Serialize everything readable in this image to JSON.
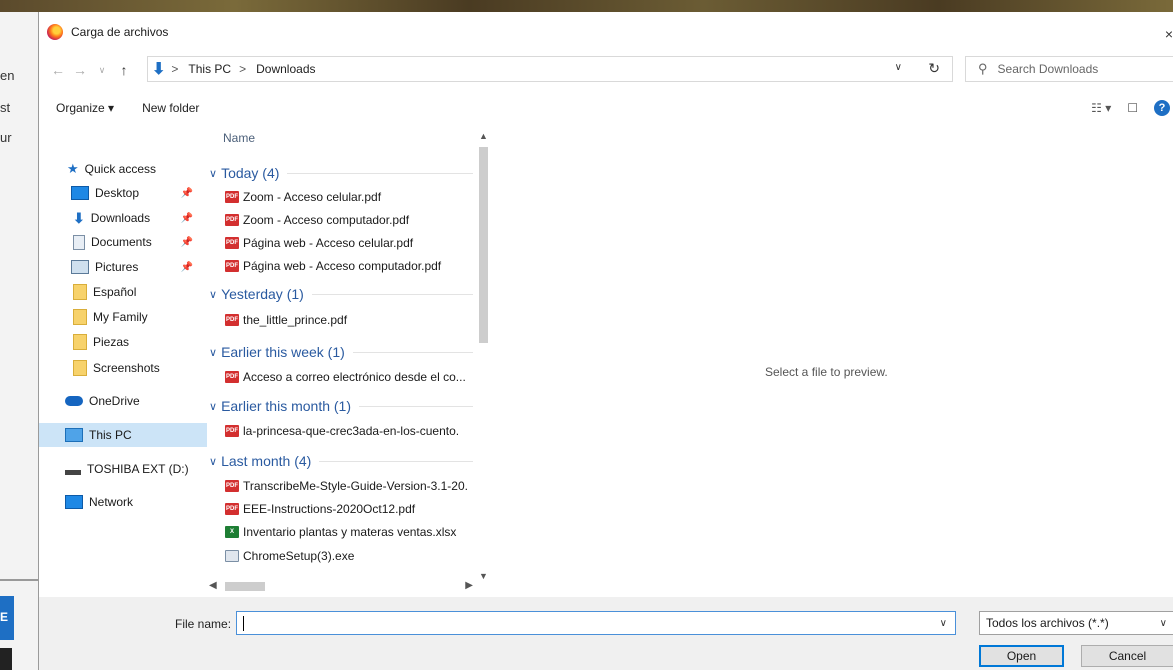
{
  "dialog": {
    "title": "Carga de archivos",
    "close_glyph": "×"
  },
  "background": {
    "frag1": "en",
    "frag2": "st",
    "frag3": "ur",
    "btn": "E"
  },
  "address": {
    "crumb1": "This PC",
    "crumb2": "Downloads",
    "sep": ">",
    "search_placeholder": "Search Downloads"
  },
  "toolbar": {
    "organize": "Organize ▾",
    "new_folder": "New folder"
  },
  "nav": {
    "items": [
      {
        "label": "Quick access"
      },
      {
        "label": "Desktop"
      },
      {
        "label": "Downloads"
      },
      {
        "label": "Documents"
      },
      {
        "label": "Pictures"
      },
      {
        "label": "Español"
      },
      {
        "label": "My Family"
      },
      {
        "label": "Piezas"
      },
      {
        "label": "Screenshots"
      },
      {
        "label": "OneDrive"
      },
      {
        "label": "This PC"
      },
      {
        "label": "TOSHIBA EXT (D:)"
      },
      {
        "label": "Network"
      }
    ]
  },
  "filelist": {
    "column": "Name",
    "groups": [
      {
        "name": "Today (4)"
      },
      {
        "name": "Yesterday (1)"
      },
      {
        "name": "Earlier this week (1)"
      },
      {
        "name": "Earlier this month (1)"
      },
      {
        "name": "Last month (4)"
      }
    ],
    "files": [
      {
        "name": "Zoom - Acceso celular.pdf",
        "type": "pdf"
      },
      {
        "name": "Zoom - Acceso computador.pdf",
        "type": "pdf"
      },
      {
        "name": "Página web - Acceso celular.pdf",
        "type": "pdf"
      },
      {
        "name": "Página web - Acceso computador.pdf",
        "type": "pdf"
      },
      {
        "name": "the_little_prince.pdf",
        "type": "pdf"
      },
      {
        "name": "Acceso a correo electrónico desde el co...",
        "type": "pdf"
      },
      {
        "name": "la-princesa-que-crec3ada-en-los-cuento.",
        "type": "pdf"
      },
      {
        "name": "TranscribeMe-Style-Guide-Version-3.1-20.",
        "type": "pdf"
      },
      {
        "name": "EEE-Instructions-2020Oct12.pdf",
        "type": "pdf"
      },
      {
        "name": "Inventario plantas y materas ventas.xlsx",
        "type": "xlsx"
      },
      {
        "name": "ChromeSetup(3).exe",
        "type": "exe"
      }
    ]
  },
  "preview": {
    "message": "Select a file to preview."
  },
  "bottom": {
    "filename_label": "File name:",
    "filename_value": "",
    "filetype": "Todos los archivos (*.*)",
    "open": "Open",
    "cancel": "Cancel"
  },
  "colors": {
    "accent": "#1e6fc4",
    "group_text": "#2a5aa0",
    "selected": "#cce4f7"
  }
}
